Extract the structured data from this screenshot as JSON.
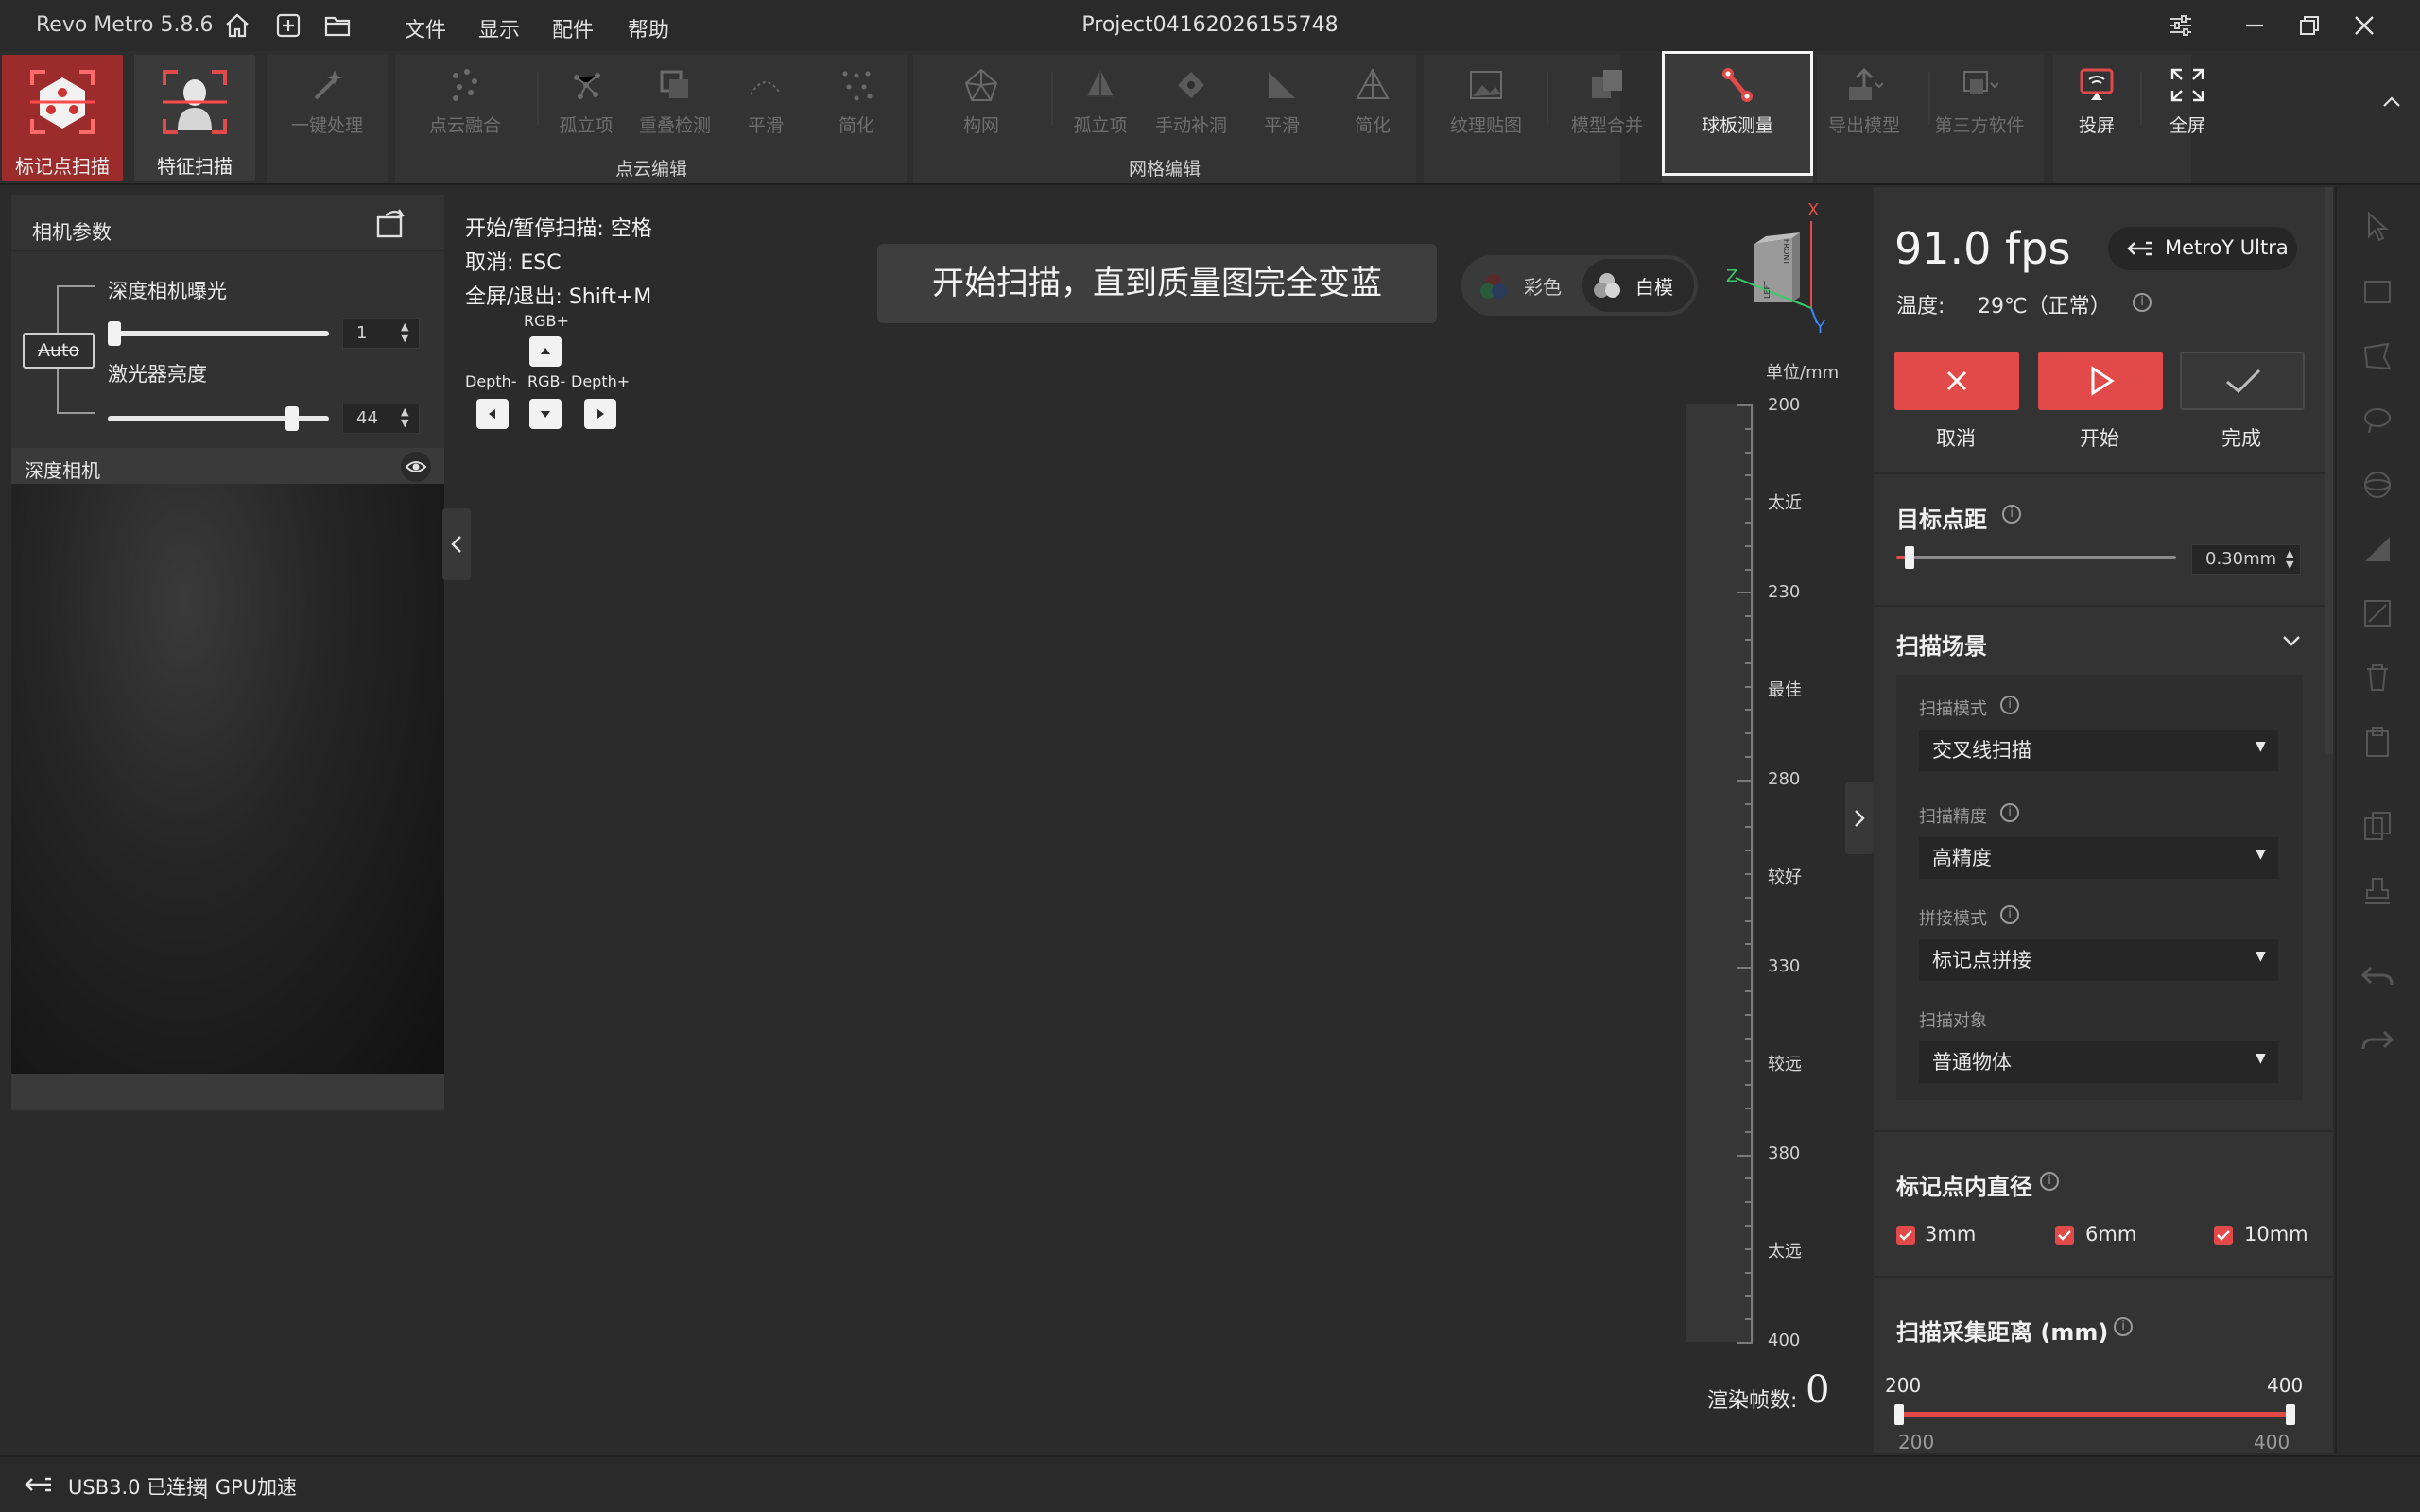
{
  "app": {
    "name": "Revo Metro 5.8.6",
    "project": "Project04162026155748",
    "menu": [
      "文件",
      "显示",
      "配件",
      "帮助"
    ]
  },
  "toolbar": {
    "marker_scan": "标记点扫描",
    "feature_scan": "特征扫描",
    "one_click": "一键处理",
    "pc_fusion": "点云融合",
    "pc_isolated": "孤立项",
    "pc_overlap": "重叠检测",
    "pc_smooth": "平滑",
    "pc_simplify": "简化",
    "pointcloud_group": "点云编辑",
    "mesh_build": "构网",
    "mesh_isolated": "孤立项",
    "mesh_fill": "手动补洞",
    "mesh_smooth": "平滑",
    "mesh_simplify": "简化",
    "mesh_group": "网格编辑",
    "texture": "纹理贴图",
    "merge": "模型合并",
    "ball_plate": "球板测量",
    "export": "导出模型",
    "third_party": "第三方软件",
    "cast": "投屏",
    "fullscreen": "全屏"
  },
  "left_panel": {
    "title": "相机参数",
    "depth_exposure_label": "深度相机曝光",
    "depth_exposure_value": "1",
    "laser_label": "激光器亮度",
    "laser_value": "44",
    "auto_label": "Auto",
    "depth_camera_label": "深度相机"
  },
  "hints": {
    "start_pause": "开始/暂停扫描:  空格",
    "cancel": "取消:  ESC",
    "fullscreen": "全屏/退出:  Shift+M",
    "rgb_plus": "RGB+",
    "depth_minus": "Depth-",
    "rgb_minus": "RGB-",
    "depth_plus": "Depth+"
  },
  "banner": "开始扫描，直到质量图完全变蓝",
  "render_mode": {
    "color": "彩色",
    "white": "白模"
  },
  "axes": {
    "x": "X",
    "y": "Y",
    "z": "Z",
    "front": "FRONT",
    "left": "LEFT"
  },
  "ruler": {
    "unit": "单位/mm",
    "ticks": [
      "200",
      "230",
      "280",
      "330",
      "380",
      "400"
    ],
    "zones": [
      "太近",
      "最佳",
      "较好",
      "较远",
      "太远"
    ]
  },
  "render_fps": {
    "label": "渲染帧数:",
    "value": "0"
  },
  "right_panel": {
    "fps": "91.0 fps",
    "device": "MetroY Ultra",
    "temperature_label": "温度:",
    "temperature_value": "29℃（正常）",
    "cancel": "取消",
    "start": "开始",
    "done": "完成",
    "target_spacing_label": "目标点距",
    "target_spacing_value": "0.30mm",
    "target_spacing_level": 0.03,
    "scene_title": "扫描场景",
    "scan_mode_label": "扫描模式",
    "scan_mode_value": "交叉线扫描",
    "precision_label": "扫描精度",
    "precision_value": "高精度",
    "stitch_label": "拼接模式",
    "stitch_value": "标记点拼接",
    "object_label": "扫描对象",
    "object_value": "普通物体",
    "marker_dia_title": "标记点内直径",
    "marker_options": [
      "3mm",
      "6mm",
      "10mm"
    ],
    "distance_title": "扫描采集距离 (mm)",
    "distance_min": "200",
    "distance_max": "400",
    "distance_low": "200",
    "distance_high": "400"
  },
  "status": {
    "connection": "USB3.0 已连接",
    "gpu": "| GPU加速"
  },
  "colors": {
    "accent": "#e24a4a",
    "bg": "#2b2b2b",
    "panel": "#333333"
  }
}
